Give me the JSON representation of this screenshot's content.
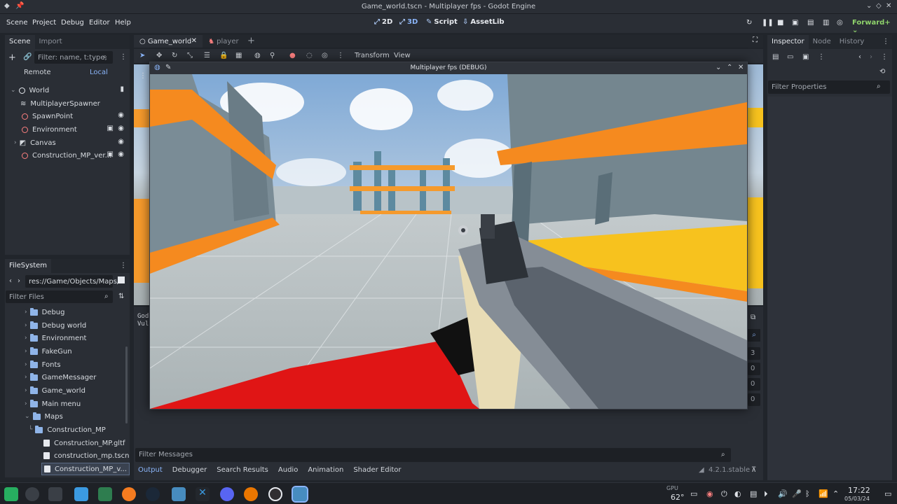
{
  "window": {
    "title": "Game_world.tscn - Multiplayer fps - Godot Engine"
  },
  "menu": [
    "Scene",
    "Project",
    "Debug",
    "Editor",
    "Help"
  ],
  "modes": [
    {
      "label": "2D",
      "icon": "2d-icon"
    },
    {
      "label": "3D",
      "icon": "3d-icon",
      "active": true
    },
    {
      "label": "Script",
      "icon": "script-icon"
    },
    {
      "label": "AssetLib",
      "icon": "assetlib-icon"
    }
  ],
  "renderer": "Forward+",
  "scene_dock": {
    "tabs": [
      "Scene",
      "Import"
    ],
    "filter_placeholder": "Filter: name, t:type,",
    "remote": "Remote",
    "local": "Local",
    "nodes": [
      {
        "name": "World",
        "depth": 0
      },
      {
        "name": "MultiplayerSpawner",
        "depth": 1
      },
      {
        "name": "SpawnPoint",
        "depth": 1
      },
      {
        "name": "Environment",
        "depth": 1
      },
      {
        "name": "Canvas",
        "depth": 1
      },
      {
        "name": "Construction_MP_ver...",
        "depth": 1
      }
    ]
  },
  "filesystem": {
    "tab": "FileSystem",
    "path": "res://Game/Objects/Maps/",
    "filter_placeholder": "Filter Files",
    "items": [
      {
        "name": "Debug",
        "type": "folder"
      },
      {
        "name": "Debug world",
        "type": "folder"
      },
      {
        "name": "Environment",
        "type": "folder"
      },
      {
        "name": "FakeGun",
        "type": "folder"
      },
      {
        "name": "Fonts",
        "type": "folder"
      },
      {
        "name": "GameMessager",
        "type": "folder"
      },
      {
        "name": "Game_world",
        "type": "folder"
      },
      {
        "name": "Main menu",
        "type": "folder"
      },
      {
        "name": "Maps",
        "type": "folder"
      },
      {
        "name": "Construction_MP",
        "type": "folder"
      },
      {
        "name": "Construction_MP.gltf",
        "type": "file"
      },
      {
        "name": "construction_mp.tscn",
        "type": "file"
      },
      {
        "name": "Construction_MP_v...",
        "type": "file"
      }
    ]
  },
  "editor_tabs": [
    "Game_world",
    "player"
  ],
  "viewport_menu": [
    "Transform",
    "View"
  ],
  "game_window": {
    "title": "Multiplayer fps (DEBUG)"
  },
  "output": {
    "lines": [
      "God",
      "Vul"
    ],
    "filter_placeholder": "Filter Messages",
    "numbers": [
      "3",
      "0",
      "0",
      "0"
    ]
  },
  "bottom_tabs": [
    "Output",
    "Debugger",
    "Search Results",
    "Audio",
    "Animation",
    "Shader Editor"
  ],
  "version": "4.2.1.stable",
  "inspector": {
    "tabs": [
      "Inspector",
      "Node",
      "History"
    ],
    "filter_placeholder": "Filter Properties"
  },
  "taskbar": {
    "gpu_label": "GPU",
    "gpu_temp": "62°",
    "time": "17:22",
    "date": "05/03/24"
  }
}
